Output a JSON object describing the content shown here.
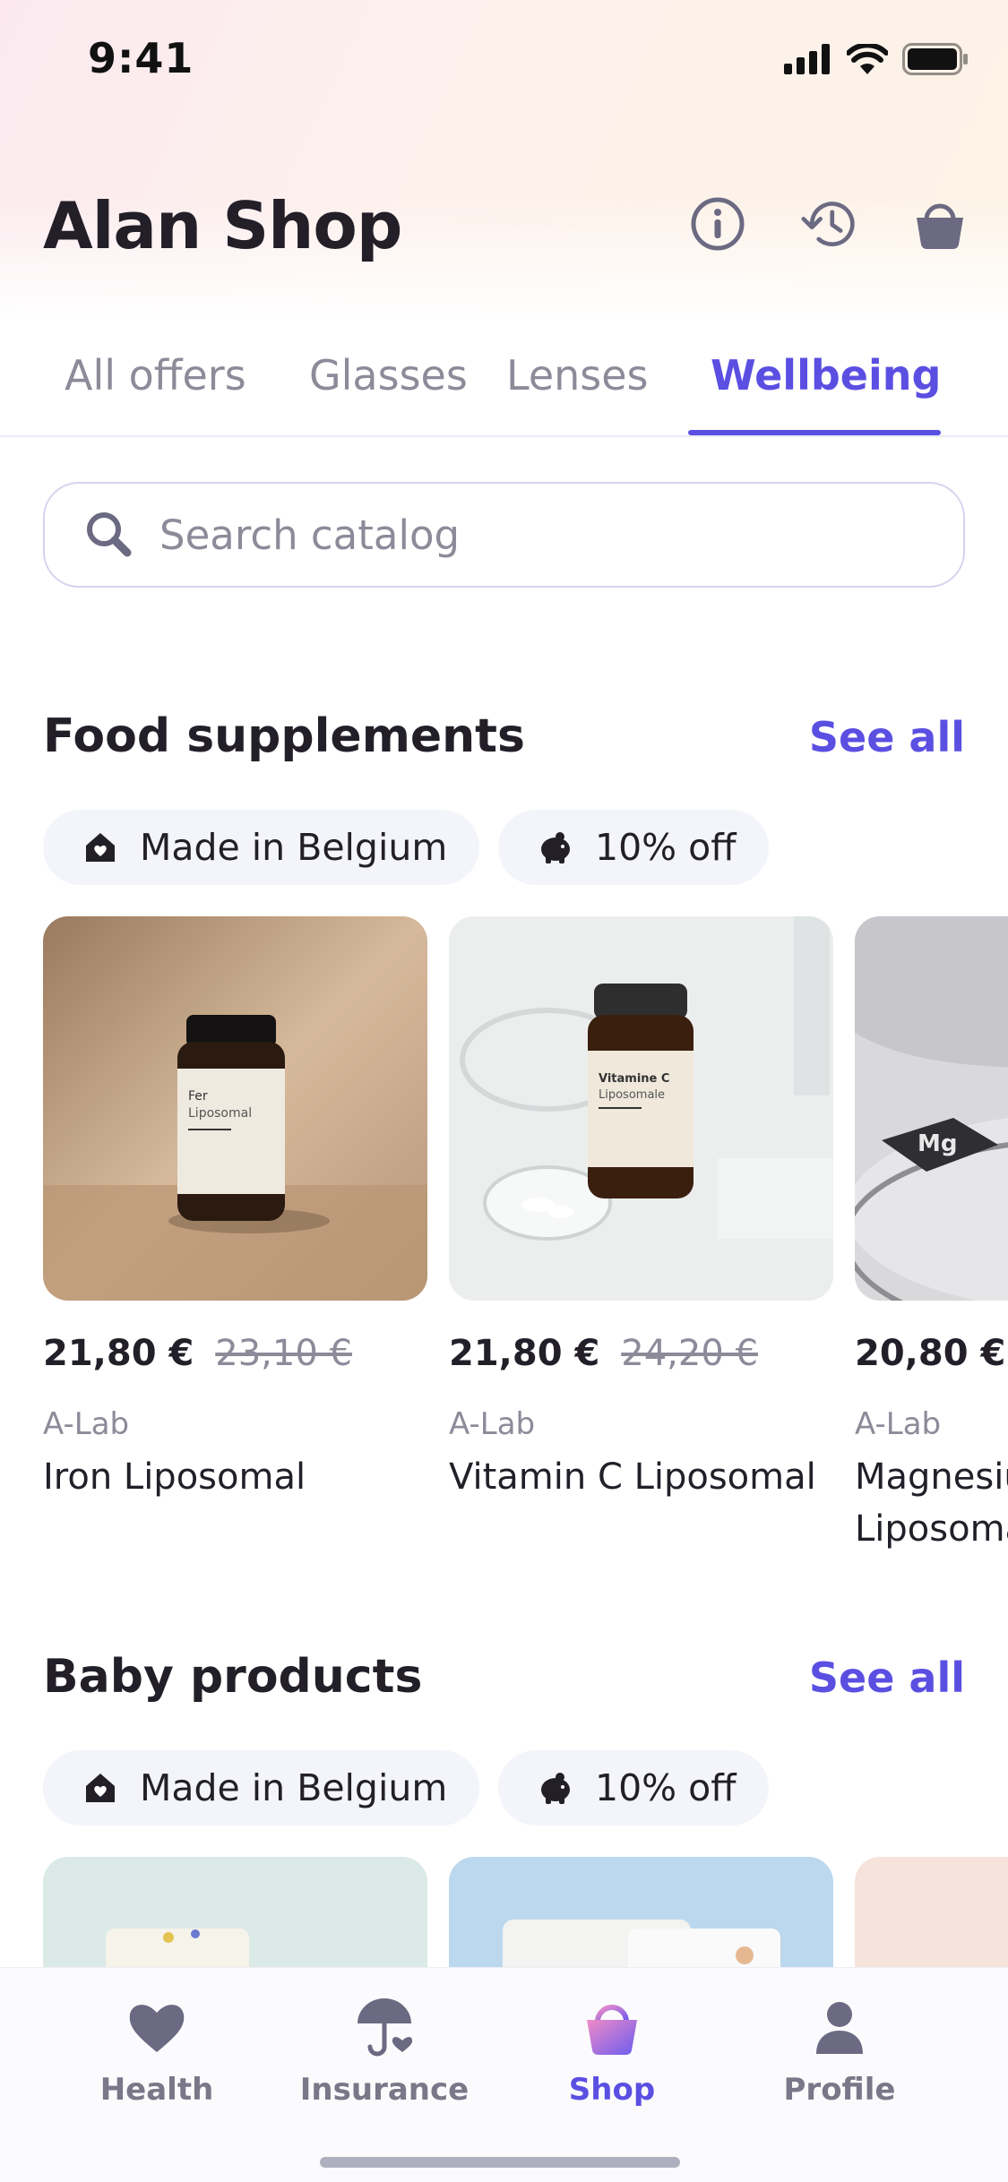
{
  "status_bar": {
    "time": "9:41"
  },
  "header": {
    "title": "Alan Shop",
    "icons": [
      "info-icon",
      "history-icon",
      "basket-icon"
    ]
  },
  "tabs": [
    {
      "label": "All offers",
      "active": false
    },
    {
      "label": "Glasses",
      "active": false
    },
    {
      "label": "Lenses",
      "active": false
    },
    {
      "label": "Wellbeing",
      "active": true
    }
  ],
  "search": {
    "placeholder": "Search catalog"
  },
  "sections": [
    {
      "title": "Food supplements",
      "see_all": "See all",
      "chips": [
        {
          "label": "Made in Belgium",
          "icon": "house-heart-icon"
        },
        {
          "label": "10% off",
          "icon": "piggy-bank-icon"
        }
      ],
      "products": [
        {
          "price": "21,80 €",
          "old_price": "23,10 €",
          "brand": "A-Lab",
          "name": "Iron Liposomal",
          "label_line1": "Fer",
          "label_line2": "Liposomal"
        },
        {
          "price": "21,80 €",
          "old_price": "24,20 €",
          "brand": "A-Lab",
          "name": "Vitamin C Liposomal",
          "label_line1": "Vitamine C",
          "label_line2": "Liposomale"
        },
        {
          "price": "20,80 €",
          "old_price": "",
          "brand": "A-Lab",
          "name": "Magnesium Liposomal",
          "label_line1": "Mg",
          "label_line2": ""
        }
      ]
    },
    {
      "title": "Baby products",
      "see_all": "See all",
      "chips": [
        {
          "label": "Made in Belgium",
          "icon": "house-heart-icon"
        },
        {
          "label": "10% off",
          "icon": "piggy-bank-icon"
        }
      ]
    }
  ],
  "colors": {
    "accent": "#5b4fe2",
    "text": "#231f29",
    "muted": "#8d8a99",
    "chip_bg": "#f3f5fb"
  },
  "bottom_nav": [
    {
      "label": "Health",
      "icon": "heart-icon",
      "active": false
    },
    {
      "label": "Insurance",
      "icon": "umbrella-icon",
      "active": false
    },
    {
      "label": "Shop",
      "icon": "basket-icon",
      "active": true
    },
    {
      "label": "Profile",
      "icon": "person-icon",
      "active": false
    }
  ]
}
